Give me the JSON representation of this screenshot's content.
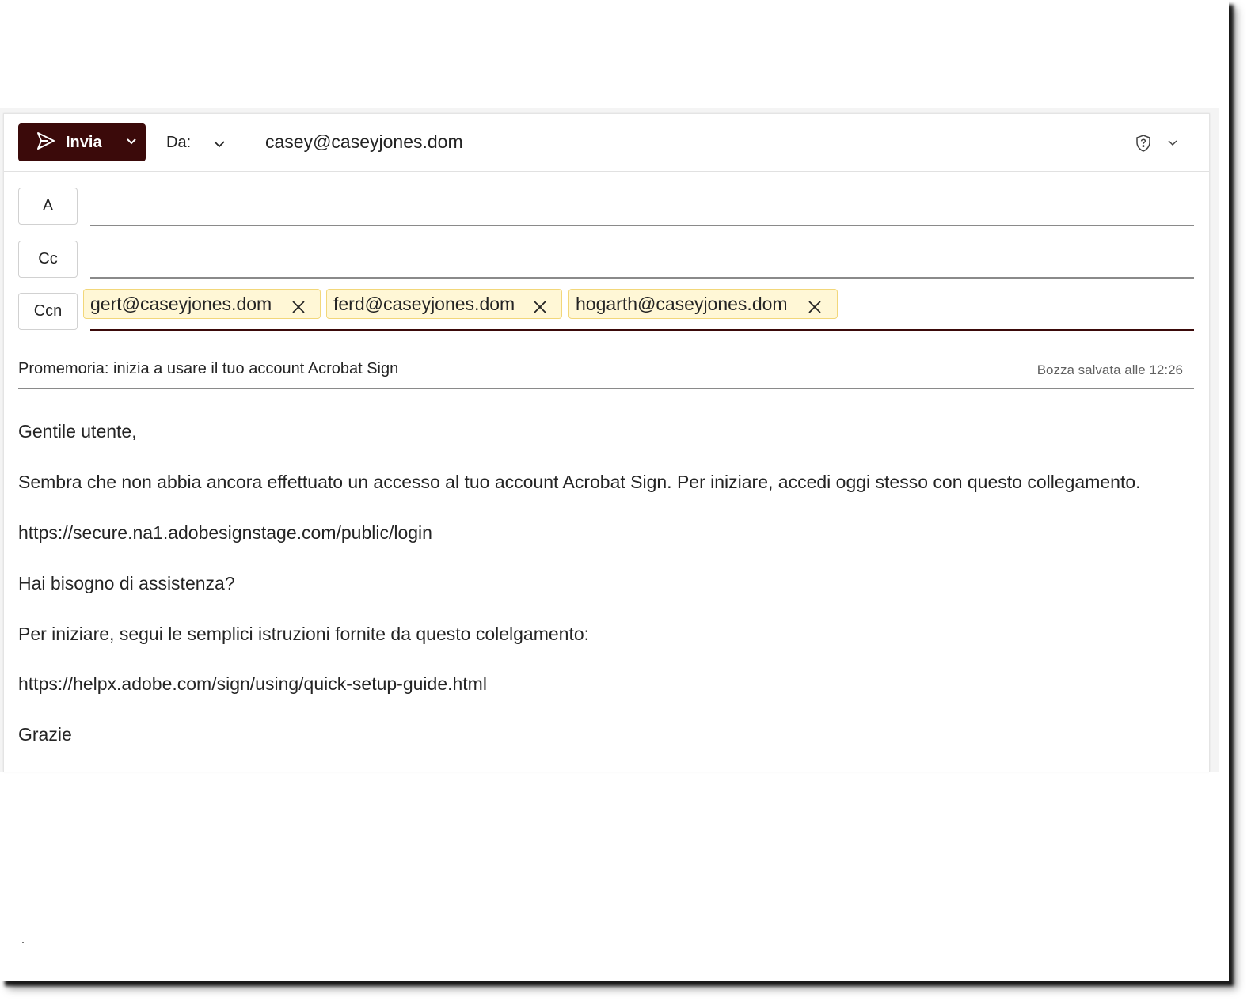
{
  "header": {
    "send_label": "Invia",
    "from_label": "Da:",
    "from_value": "casey@caseyjones.dom",
    "icons": {
      "send": "send-icon",
      "split": "chevron-down-icon",
      "from_dropdown": "chevron-down-icon",
      "sensitivity": "shield-question-icon",
      "sensitivity_dropdown": "chevron-down-icon"
    }
  },
  "recipients": {
    "to_label": "A",
    "cc_label": "Cc",
    "bcc_label": "Ccn",
    "bcc_chips": [
      {
        "address": "gert@caseyjones.dom",
        "remove_icon": "close-icon"
      },
      {
        "address": "ferd@caseyjones.dom",
        "remove_icon": "close-icon"
      },
      {
        "address": "hogarth@caseyjones.dom",
        "remove_icon": "close-icon"
      }
    ]
  },
  "subject": {
    "value": "Promemoria: inizia a usare il tuo account Acrobat Sign",
    "draft_status": "Bozza salvata alle 12:26"
  },
  "body": {
    "greeting": "Gentile utente,",
    "paragraph1": "Sembra che non abbia ancora effettuato un accesso al tuo account Acrobat Sign. Per iniziare, accedi oggi stesso con questo collegamento.",
    "login_link": "https://secure.na1.adobesignstage.com/public/login",
    "help_question": "Hai bisogno di assistenza?",
    "paragraph2": "Per iniziare, segui le semplici istruzioni fornite da questo colelgamento:",
    "guide_link": "https://helpx.adobe.com/sign/using/quick-setup-guide.html",
    "closing": "Grazie"
  },
  "colors": {
    "accent": "#3b0a0a",
    "chip_bg": "#fff7d6",
    "chip_border": "#f2d77a",
    "text": "#242424",
    "muted_text": "#616161"
  }
}
